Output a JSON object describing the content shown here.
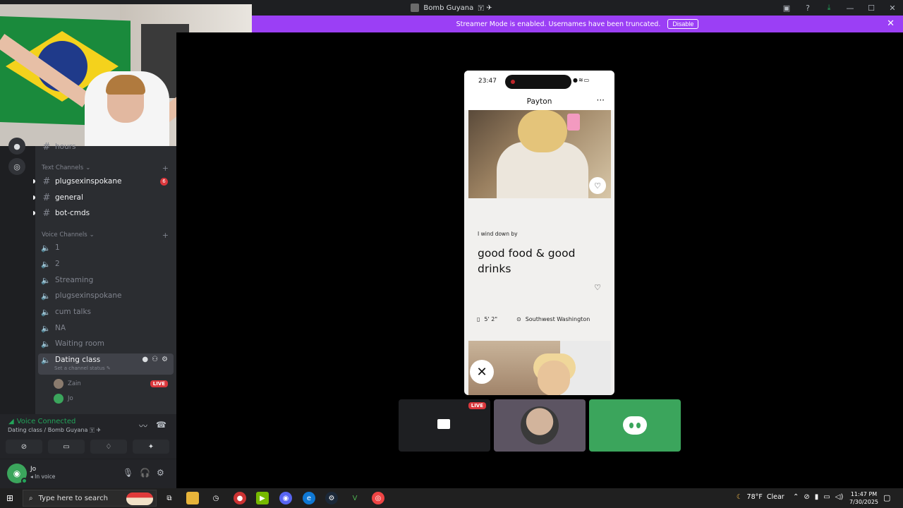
{
  "window": {
    "title": "Bomb Guyana",
    "title_flags": "🇾 ✈"
  },
  "titlebar_icons": [
    "inbox-icon",
    "help-icon",
    "download-icon"
  ],
  "window_controls": [
    "—",
    "☐",
    "✕"
  ],
  "banner": {
    "text": "Streamer Mode is enabled. Usernames have been truncated.",
    "button": "Disable"
  },
  "channels": {
    "partial_top": "hours",
    "text_category": "Text Channels",
    "text": [
      {
        "name": "plugsexinspokane",
        "badge": "6"
      },
      {
        "name": "general"
      },
      {
        "name": "bot-cmds"
      }
    ],
    "voice_category": "Voice Channels",
    "voice": [
      "1",
      "2",
      "Streaming",
      "plugsexinspokane",
      "cum talks",
      "NA",
      "Waiting room"
    ],
    "selected": {
      "name": "Dating class",
      "status": "Set a channel status"
    },
    "members": [
      {
        "name": "Zain",
        "live": "LIVE"
      },
      {
        "name": "Jo"
      }
    ]
  },
  "voice_panel": {
    "status": "Voice Connected",
    "location": "Dating class / Bomb Guyana"
  },
  "user_panel": {
    "name": "Jo",
    "status": "In voice"
  },
  "phone": {
    "time": "23:47",
    "profile_name": "Payton",
    "prompt": "I wind down by",
    "answer": "good food & good drinks",
    "height": "5' 2\"",
    "location": "Southwest Washington"
  },
  "tiles": {
    "live": "LIVE"
  },
  "taskbar": {
    "search_placeholder": "Type here to search",
    "weather_temp": "78°F",
    "weather_text": "Clear",
    "time": "11:47 PM",
    "date": "7/30/2025"
  },
  "colors": {
    "banner": "#9b3ff5",
    "voice_connected": "#23a55a",
    "live": "#da373c",
    "discord_green": "#3ba55c"
  }
}
